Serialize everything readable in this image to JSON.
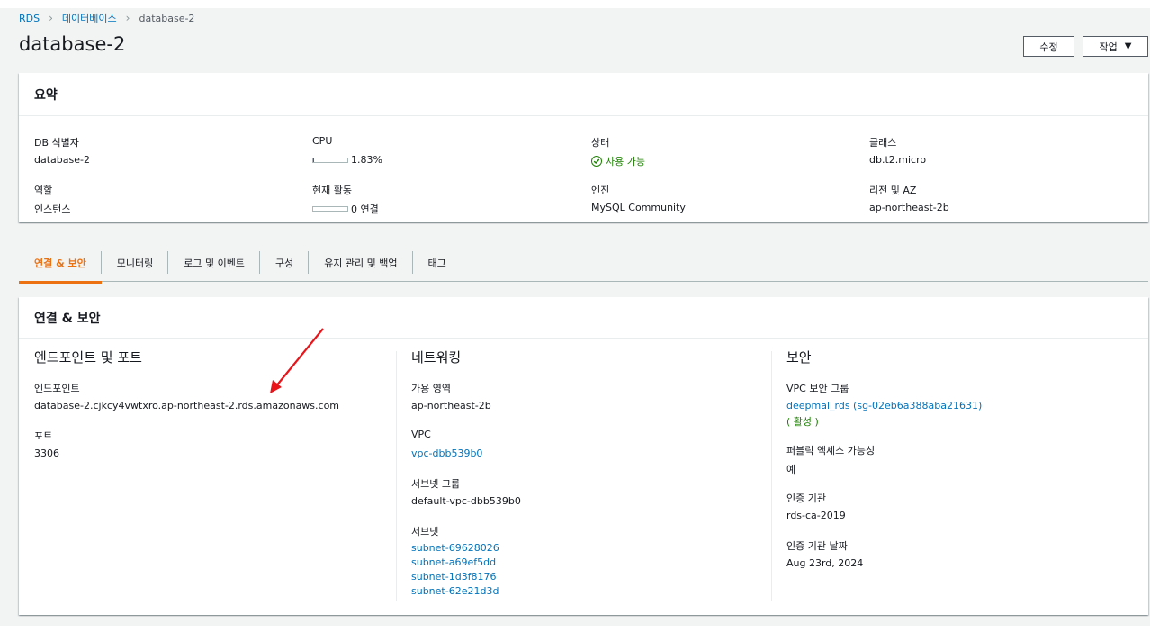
{
  "breadcrumb": {
    "root": "RDS",
    "parent": "데이터베이스",
    "current": "database-2"
  },
  "page_title": "database-2",
  "header_buttons": {
    "edit": "수정",
    "actions": "작업"
  },
  "summary": {
    "title": "요약",
    "db_id_label": "DB 식별자",
    "db_id": "database-2",
    "cpu_label": "CPU",
    "cpu_value": "1.83%",
    "cpu_fraction": 0.0183,
    "status_label": "상태",
    "status_value": "사용 가능",
    "class_label": "클래스",
    "class_value": "db.t2.micro",
    "role_label": "역할",
    "role_value": "인스턴스",
    "activity_label": "현재 활동",
    "activity_value": "0 연결",
    "activity_fraction": 0,
    "engine_label": "엔진",
    "engine_value": "MySQL Community",
    "region_label": "리전 및 AZ",
    "region_value": "ap-northeast-2b"
  },
  "tabs": [
    "연결 & 보안",
    "모니터링",
    "로그 및 이벤트",
    "구성",
    "유지 관리 및 백업",
    "태그"
  ],
  "connectivity": {
    "title": "연결 & 보안",
    "endpoint_section": {
      "heading": "엔드포인트 및 포트",
      "endpoint_label": "엔드포인트",
      "endpoint_value": "database-2.cjkcy4vwtxro.ap-northeast-2.rds.amazonaws.com",
      "port_label": "포트",
      "port_value": "3306"
    },
    "network_section": {
      "heading": "네트워킹",
      "az_label": "가용 영역",
      "az_value": "ap-northeast-2b",
      "vpc_label": "VPC",
      "vpc_value": "vpc-dbb539b0",
      "subnet_group_label": "서브넷 그룹",
      "subnet_group_value": "default-vpc-dbb539b0",
      "subnets_label": "서브넷",
      "subnets": [
        "subnet-69628026",
        "subnet-a69ef5dd",
        "subnet-1d3f8176",
        "subnet-62e21d3d"
      ]
    },
    "security_section": {
      "heading": "보안",
      "sg_label": "VPC 보안 그룹",
      "sg_value": "deepmal_rds (sg-02eb6a388aba21631)",
      "sg_status": "( 활성 )",
      "public_label": "퍼블릭 액세스 가능성",
      "public_value": "예",
      "ca_label": "인증 기관",
      "ca_value": "rds-ca-2019",
      "ca_date_label": "인증 기관 날짜",
      "ca_date_value": "Aug 23rd, 2024"
    }
  },
  "colors": {
    "link": "#0073bb",
    "success": "#1d8102",
    "tab_active": "#ec7211",
    "annotation_arrow": "#e8141a"
  }
}
